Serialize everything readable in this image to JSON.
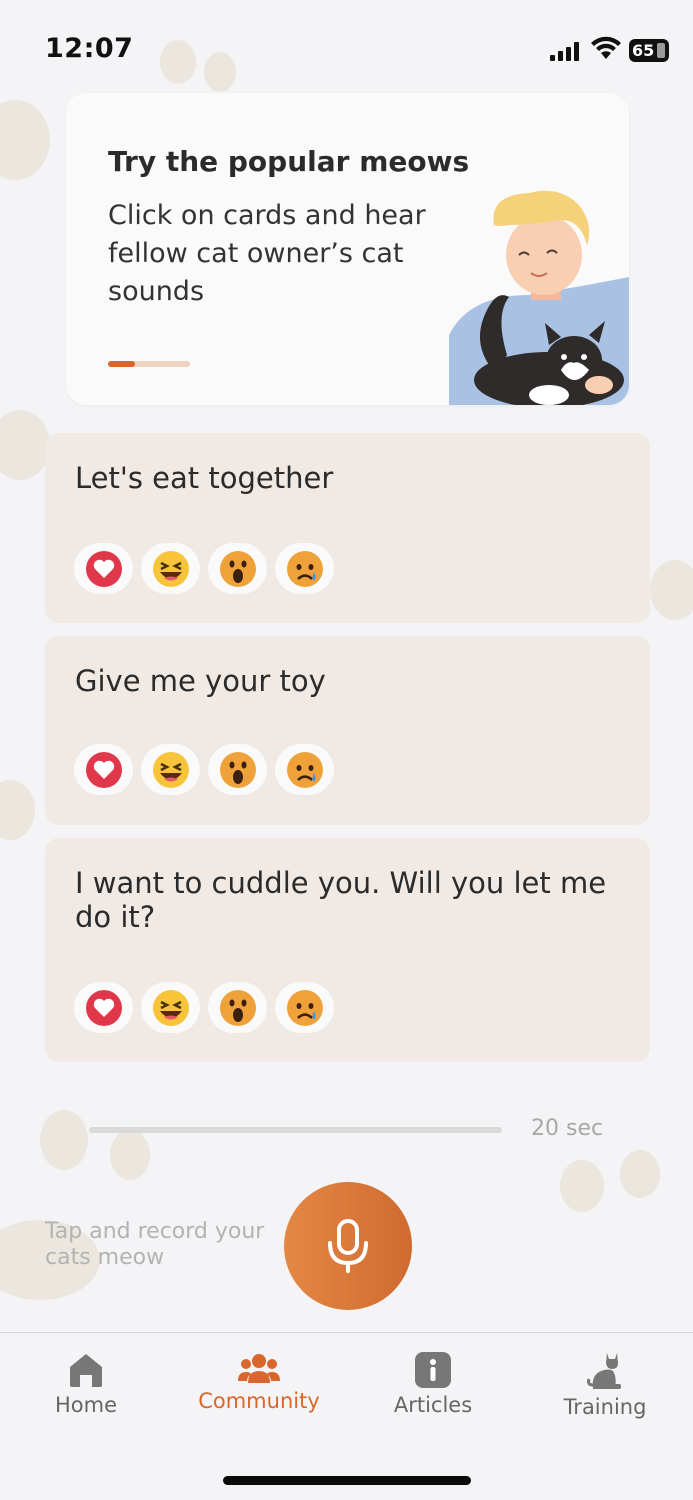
{
  "status_bar": {
    "time": "12:07",
    "battery": "65",
    "icons": [
      "signal-icon",
      "wifi-icon",
      "battery-icon"
    ]
  },
  "promo": {
    "title": "Try the popular meows",
    "text": "Click on cards and hear fellow cat owner’s cat sounds",
    "progress": 0.33,
    "illustration": "person-holding-cat-illustration"
  },
  "meow_cards": [
    {
      "text": "Let's eat together"
    },
    {
      "text": "Give me your toy"
    },
    {
      "text": "I want to cuddle you. Will you let me do it?"
    }
  ],
  "reactions": [
    "heart-icon",
    "laughing-face-icon",
    "shocked-face-icon",
    "sad-face-icon"
  ],
  "recorder": {
    "timer_label": "20 sec",
    "hint": "Tap and record your cats meow",
    "button_icon": "microphone-icon"
  },
  "tabs": [
    {
      "label": "Home",
      "icon": "home-icon",
      "active": false
    },
    {
      "label": "Community",
      "icon": "community-icon",
      "active": true
    },
    {
      "label": "Articles",
      "icon": "info-icon",
      "active": false
    },
    {
      "label": "Training",
      "icon": "cat-icon",
      "active": false
    }
  ],
  "colors": {
    "accent": "#d9672d",
    "card_bg": "#f1e9e3",
    "page_bg": "#f4f3f6"
  }
}
